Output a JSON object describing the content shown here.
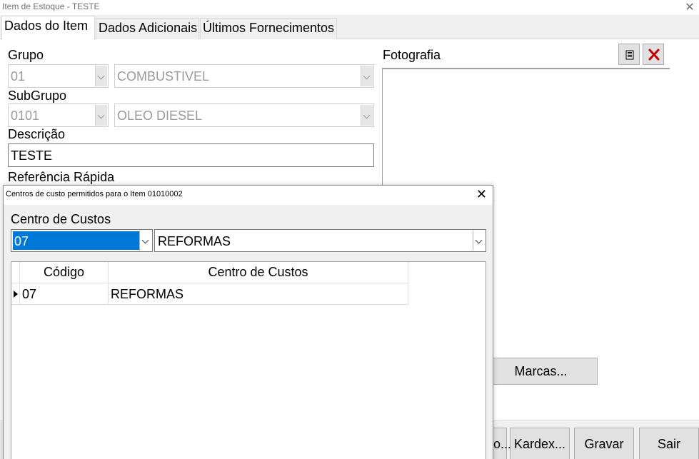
{
  "window": {
    "title": "Item de Estoque - TESTE",
    "close_glyph": "✕"
  },
  "tabs": [
    {
      "label": "Dados do Item",
      "active": true
    },
    {
      "label": "Dados Adicionais",
      "active": false
    },
    {
      "label": "Últimos Fornecimentos",
      "active": false
    }
  ],
  "form": {
    "grupo_label": "Grupo",
    "grupo_code": "01",
    "grupo_name": "COMBUSTIVEL",
    "subgrupo_label": "SubGrupo",
    "subgrupo_code": "0101",
    "subgrupo_name": "OLEO DIESEL",
    "descricao_label": "Descrição",
    "descricao_value": "TESTE",
    "referencia_label": "Referência Rápida",
    "fotografia_label": "Fotografia"
  },
  "buttons": {
    "marcas": "Marcas...",
    "partial": "o...",
    "kardex": "Kardex...",
    "gravar": "Gravar",
    "sair": "Sair"
  },
  "icons": {
    "list_icon": "list-icon",
    "delete_icon": "delete-x-icon",
    "delete_color": "#c00000"
  },
  "dialog": {
    "title": "Centros de custo permitidos para o Item 01010002",
    "close_glyph": "✕",
    "field_label": "Centro de Custos",
    "selected_code": "07",
    "selected_name": "REFORMAS",
    "selection_color": "#0078d7",
    "grid": {
      "columns": [
        "Código",
        "Centro de Custos"
      ],
      "rows": [
        {
          "codigo": "07",
          "centro": "REFORMAS"
        }
      ]
    }
  }
}
